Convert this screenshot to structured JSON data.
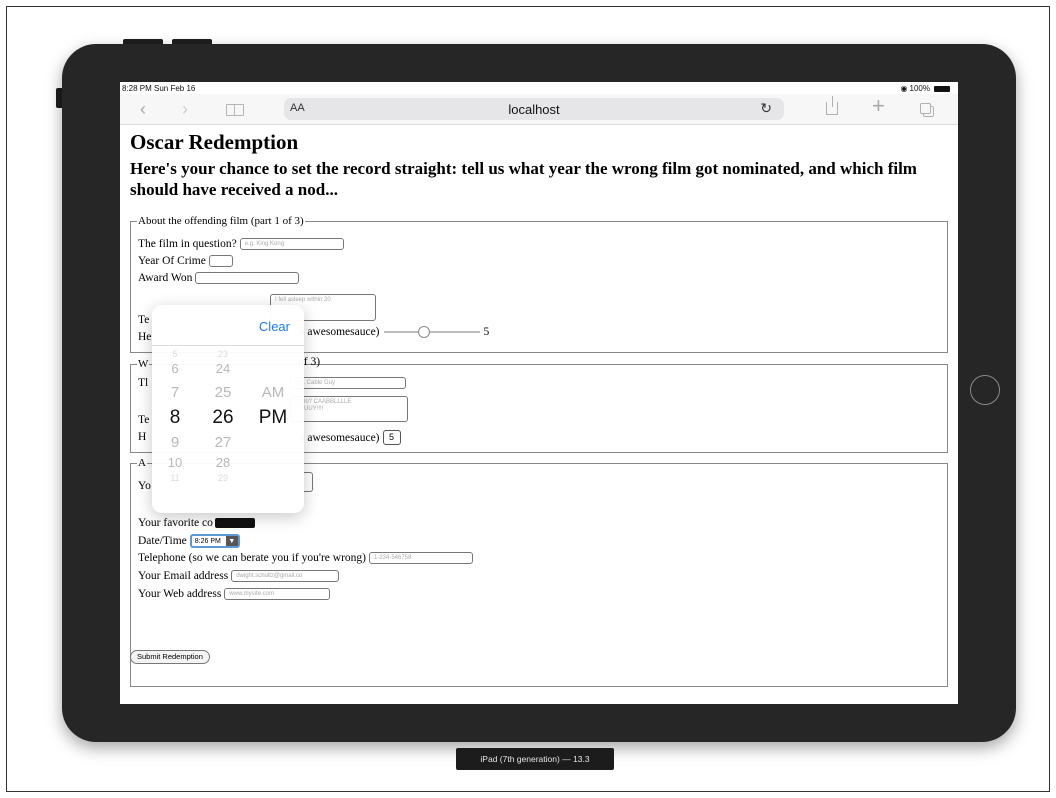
{
  "status_bar": {
    "time": "8:28 PM  Sun Feb 16",
    "wifi_icon": "wifi-icon",
    "battery": "100%"
  },
  "toolbar": {
    "back_icon": "chevron-left-icon",
    "forward_icon": "chevron-right-icon",
    "bookmarks_icon": "book-icon",
    "text_size": "AA",
    "url": "localhost",
    "reload_icon": "reload-icon",
    "share_icon": "share-icon",
    "new_tab_icon": "plus-icon",
    "tabs_icon": "tabs-icon"
  },
  "page": {
    "title": "Oscar Redemption",
    "subtitle": "Here's your chance to set the record straight: tell us what year the wrong film got nominated, and which film should have received a nod..."
  },
  "section1": {
    "legend": "About the offending film (part 1 of 3)",
    "film_label": "The film in question?",
    "film_placeholder": "e.g. King Kong",
    "year_label": "Year Of Crime",
    "award_label": "Award Won",
    "textarea_placeholder_1": "I fell asleep within 20",
    "textarea_placeholder_2": "...",
    "partial_label_1": "Te",
    "partial_label_2": "He",
    "rating_label_end": "s awesomesauce)",
    "rating_value": "5"
  },
  "section2": {
    "legend_start": "W",
    "legend_end": "of 3)",
    "row1_partial": "Tl",
    "film_placeholder": "e.g. Cable Guy",
    "textarea_placeholder_1": "Hello? CAABBLLLLE",
    "textarea_placeholder_2": "GUUUY!!!!",
    "partial_label_1": "Te",
    "partial_label_2": "H",
    "rating_label_end": "s awesomesauce)",
    "rating_value": "5"
  },
  "section3": {
    "legend_start": "A",
    "row1_partial": "Yo",
    "color_label": "Your favorite co",
    "datetime_label": "Date/Time",
    "datetime_value": "8:26 PM",
    "phone_label": "Telephone (so we can berate you if you're wrong)",
    "phone_placeholder": "1-234-546758",
    "email_label": "Your Email address",
    "email_placeholder": "dwight.schultz@gmail.co",
    "web_label": "Your Web address",
    "web_placeholder": "www.mysite.com"
  },
  "submit_label": "Submit Redemption",
  "time_picker": {
    "clear_label": "Clear",
    "hours": [
      "6",
      "7",
      "8",
      "9",
      "10",
      "11"
    ],
    "hours_top": "5",
    "minutes_top": "23",
    "minutes": [
      "24",
      "25",
      "26",
      "27",
      "28",
      "29"
    ],
    "ampm": [
      "AM",
      "PM"
    ],
    "selected_hour": "8",
    "selected_minute": "26",
    "selected_ampm": "PM"
  },
  "device_label": "iPad (7th generation) — 13.3"
}
